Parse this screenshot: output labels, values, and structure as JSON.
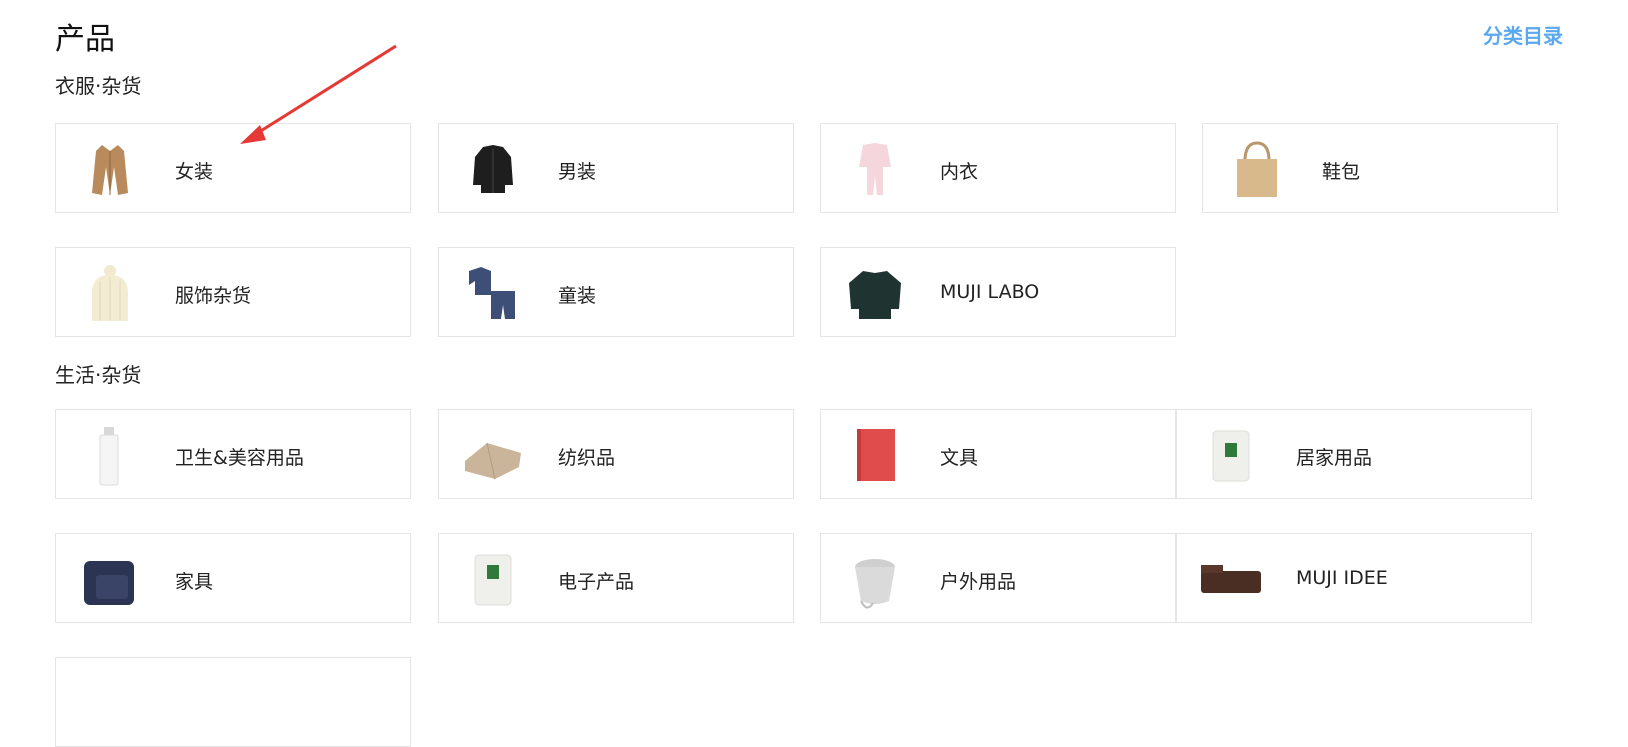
{
  "header": {
    "title": "产品",
    "catalog_link": "分类目录"
  },
  "sections": [
    {
      "title": "衣服·杂货",
      "items": [
        {
          "label": "女装",
          "icon": "coat-icon"
        },
        {
          "label": "男装",
          "icon": "jacket-icon"
        },
        {
          "label": "内衣",
          "icon": "pajamas-icon"
        },
        {
          "label": "鞋包",
          "icon": "tote-bag-icon"
        },
        {
          "label": "服饰杂货",
          "icon": "knit-hat-icon"
        },
        {
          "label": "童装",
          "icon": "kids-outfit-icon"
        },
        {
          "label": "MUJI LABO",
          "icon": "sweater-icon"
        }
      ]
    },
    {
      "title": "生活·杂货",
      "items": [
        {
          "label": "卫生&美容用品",
          "icon": "toner-bottle-icon"
        },
        {
          "label": "纺织品",
          "icon": "folded-towel-icon"
        },
        {
          "label": "文具",
          "icon": "notebook-icon"
        },
        {
          "label": "居家用品",
          "icon": "candle-icon"
        },
        {
          "label": "家具",
          "icon": "sofa-chair-icon"
        },
        {
          "label": "电子产品",
          "icon": "diffuser-icon"
        },
        {
          "label": "户外用品",
          "icon": "basket-icon"
        },
        {
          "label": "MUJI IDEE",
          "icon": "sofa-icon"
        }
      ]
    }
  ],
  "annotation": {
    "color": "#e53935"
  }
}
